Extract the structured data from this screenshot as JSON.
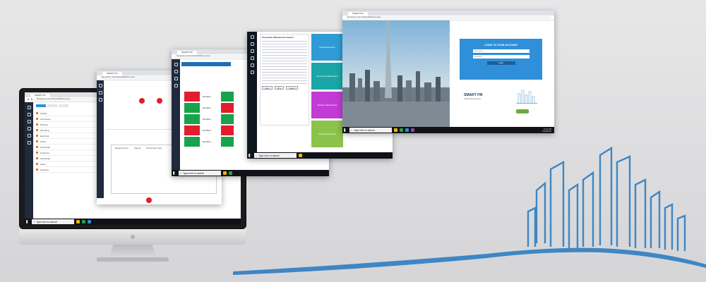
{
  "taskbar": {
    "search_placeholder": "Type here to search",
    "clock_time": "12:41 PM",
    "clock_date": "01/06/2020"
  },
  "browser": {
    "tab_title": "SMART FM",
    "url_text": "Not secure | 10.xxx/SmartFM/Home.aspx"
  },
  "screen1": {
    "rows": [
      "Facility",
      "Civil works",
      "Painting",
      "Plumbing",
      "Electrical",
      "HVAC",
      "Technician",
      "Carpentry",
      "Technician",
      "Glass",
      "Cleaning"
    ]
  },
  "screen2": {
    "header_labels": [
      "Request From",
      "Ageing",
      "Permission Type"
    ]
  },
  "screen3": {
    "status": [
      "Rectified",
      "Rectified",
      "Rectified",
      "Rectified",
      "Rectified"
    ]
  },
  "screen4": {
    "form_title": "Preventive Maintenance Search",
    "buttons": [
      "Clear",
      "Print",
      "Search"
    ],
    "tiles": [
      "Total Maintenance",
      "Preventive Maintenance",
      "Reactive Maintenance",
      "Rejected Requests"
    ]
  },
  "login": {
    "title": "LOGIN TO YOUR ACCOUNT",
    "username_placeholder": "Username",
    "password_placeholder": "Password",
    "login_button": "Login",
    "logo_text": "SMART FM",
    "logo_sub": "Facility Management"
  },
  "colors": {
    "accent_blue": "#2f8fd8",
    "skyline": "#3e86c4",
    "status_green": "#16a34a",
    "status_red": "#e11d2e",
    "taskbar": "#101217"
  }
}
